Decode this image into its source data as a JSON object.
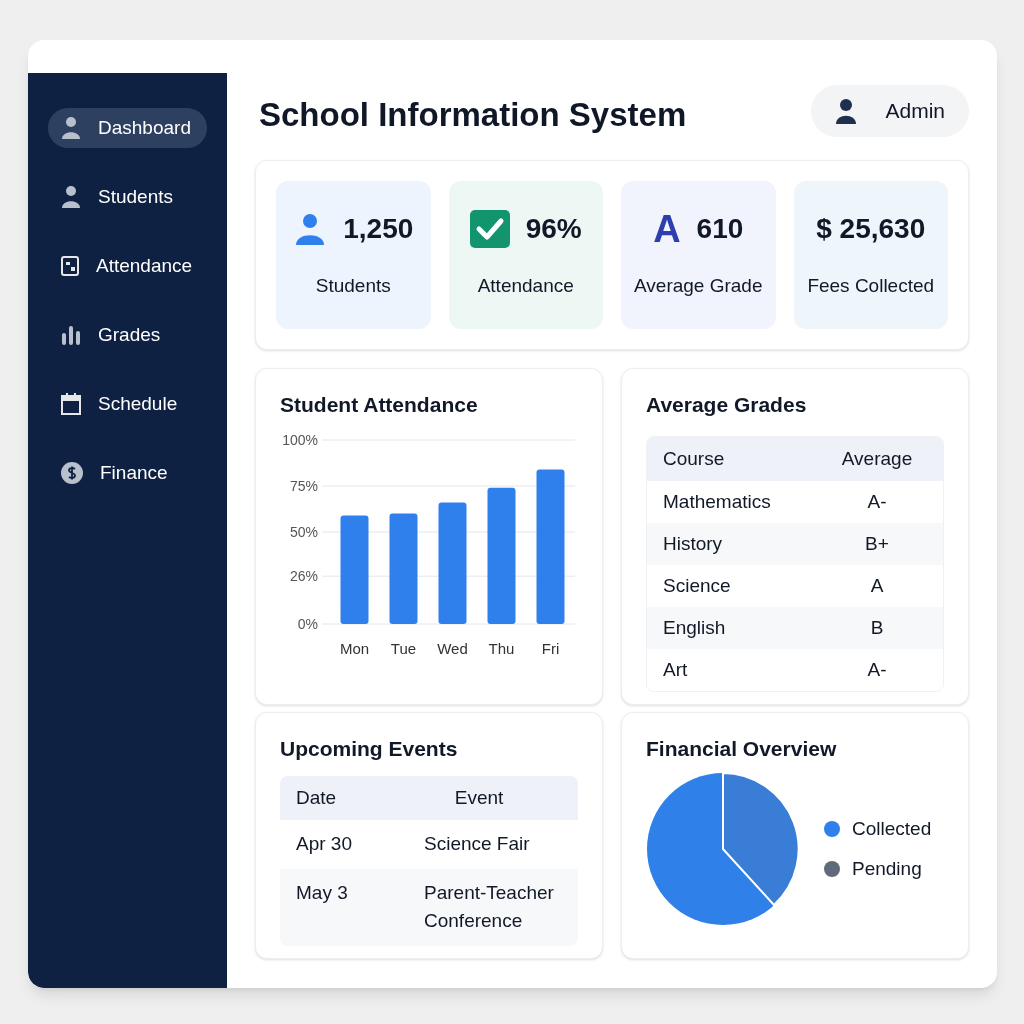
{
  "app_title": "School Information System",
  "user": {
    "name": "Admin"
  },
  "sidebar": {
    "items": [
      {
        "label": "Dashboard",
        "kind": "person",
        "selected": true
      },
      {
        "label": "Students",
        "kind": "person",
        "selected": false
      },
      {
        "label": "Attendance",
        "kind": "daily",
        "selected": false
      },
      {
        "label": "Grades",
        "kind": "bars",
        "selected": false
      },
      {
        "label": "Schedule",
        "kind": "calendar",
        "selected": false
      },
      {
        "label": "Finance",
        "kind": "money",
        "selected": false
      }
    ]
  },
  "stats": [
    {
      "kind": "students",
      "value": "1,250",
      "label": "Students"
    },
    {
      "kind": "attendance",
      "value": "96%",
      "label": "Attendance"
    },
    {
      "kind": "grade",
      "icon_text": "A",
      "value": "610",
      "label": "Average Grade"
    },
    {
      "kind": "fees",
      "value": "$ 25,630",
      "label": "Fees Collected"
    }
  ],
  "attendance_panel": {
    "title": "Student Attendance",
    "chart_data": {
      "type": "bar",
      "categories": [
        "Mon",
        "Tue",
        "Wed",
        "Thu",
        "Fri"
      ],
      "series": [
        {
          "color": "#2f80ed",
          "values": [
            59,
            60,
            66,
            74,
            84
          ]
        }
      ],
      "ylim": [
        0,
        100
      ],
      "grid": true,
      "yticks": [
        {
          "value": 0,
          "label": "0%"
        },
        {
          "value": 26,
          "label": "26%"
        },
        {
          "value": 50,
          "label": "50%"
        },
        {
          "value": 75,
          "label": "75%"
        },
        {
          "value": 100,
          "label": "100%"
        }
      ]
    }
  },
  "grades_panel": {
    "title": "Average Grades",
    "columns": [
      "Course",
      "Average"
    ],
    "rows": [
      [
        "Mathematics",
        "A-"
      ],
      [
        "History",
        "B+"
      ],
      [
        "Science",
        "A"
      ],
      [
        "English",
        "B"
      ],
      [
        "Art",
        "A-"
      ]
    ]
  },
  "events_panel": {
    "title": "Upcoming Events",
    "columns": [
      "Date",
      "Event"
    ],
    "rows": [
      [
        "Apr 30",
        "Science Fair"
      ],
      [
        "May 3",
        "Parent-Teacher Conference"
      ]
    ]
  },
  "finance_panel": {
    "title": "Financial Overview",
    "legend": [
      {
        "label": "Collected",
        "color": "#2f80ed"
      },
      {
        "label": "Pending",
        "color": "#5f6b7a"
      }
    ]
  }
}
